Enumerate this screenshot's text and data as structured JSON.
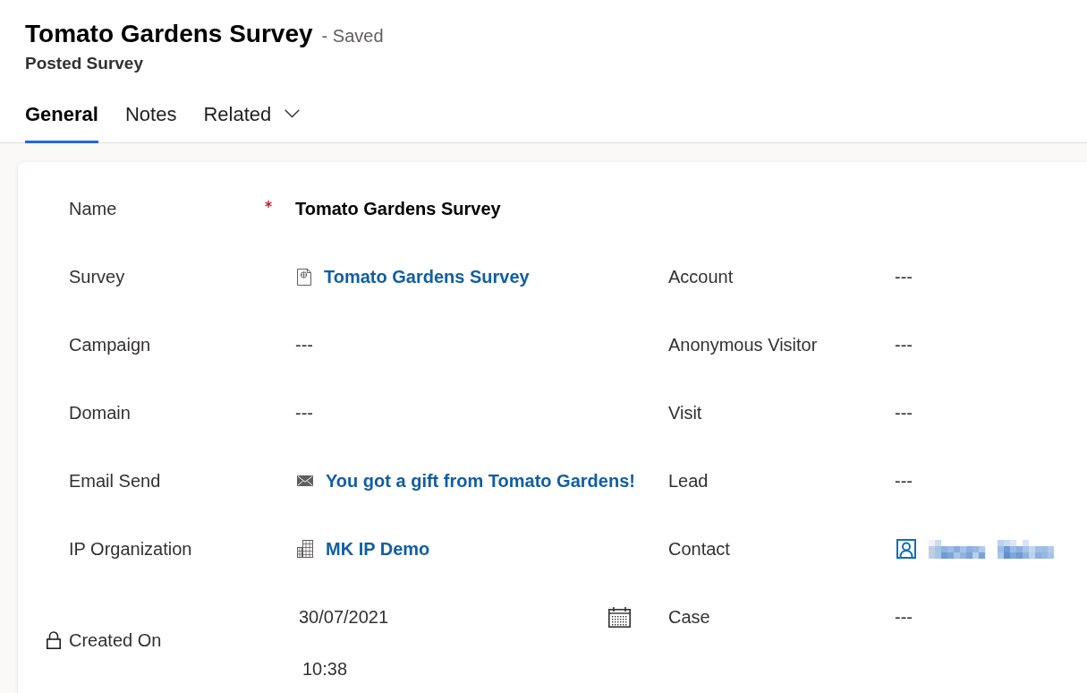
{
  "header": {
    "title": "Tomato Gardens Survey",
    "save_status": "- Saved",
    "entity": "Posted Survey"
  },
  "tabs": [
    {
      "label": "General",
      "selected": true,
      "dropdown": false
    },
    {
      "label": "Notes",
      "selected": false,
      "dropdown": false
    },
    {
      "label": "Related",
      "selected": false,
      "dropdown": true
    }
  ],
  "form": {
    "rows": [
      {
        "left": {
          "label": "Name",
          "required": true,
          "locked": false,
          "value": {
            "kind": "text",
            "text": "Tomato Gardens Survey"
          }
        }
      },
      {
        "left": {
          "label": "Survey",
          "required": false,
          "locked": false,
          "value": {
            "kind": "survey_lookup",
            "text": "Tomato Gardens Survey"
          }
        },
        "right": {
          "label": "Account",
          "required": false,
          "locked": false,
          "value": {
            "kind": "empty",
            "text": "---"
          }
        }
      },
      {
        "left": {
          "label": "Campaign",
          "required": false,
          "locked": false,
          "value": {
            "kind": "empty",
            "text": "---"
          }
        },
        "right": {
          "label": "Anonymous Visitor",
          "required": false,
          "locked": false,
          "value": {
            "kind": "empty",
            "text": "---"
          }
        }
      },
      {
        "left": {
          "label": "Domain",
          "required": false,
          "locked": false,
          "value": {
            "kind": "empty",
            "text": "---"
          }
        },
        "right": {
          "label": "Visit",
          "required": false,
          "locked": false,
          "value": {
            "kind": "empty",
            "text": "---"
          }
        }
      },
      {
        "left": {
          "label": "Email Send",
          "required": false,
          "locked": false,
          "value": {
            "kind": "email_lookup",
            "text": "You got a gift from Tomato Gardens!"
          }
        },
        "right": {
          "label": "Lead",
          "required": false,
          "locked": false,
          "value": {
            "kind": "empty",
            "text": "---"
          }
        }
      },
      {
        "left": {
          "label": "IP Organization",
          "required": false,
          "locked": false,
          "value": {
            "kind": "account_lookup",
            "text": "MK IP Demo"
          }
        },
        "right": {
          "label": "Contact",
          "required": false,
          "locked": false,
          "value": {
            "kind": "contact_lookup",
            "redacted": true
          }
        }
      },
      {
        "left": {
          "label": "Created On",
          "required": false,
          "locked": true,
          "value": {
            "kind": "datetime",
            "date": "30/07/2021",
            "time": "10:38"
          }
        },
        "right": {
          "label": "Case",
          "required": false,
          "locked": false,
          "value": {
            "kind": "empty",
            "text": "---"
          }
        }
      }
    ]
  }
}
